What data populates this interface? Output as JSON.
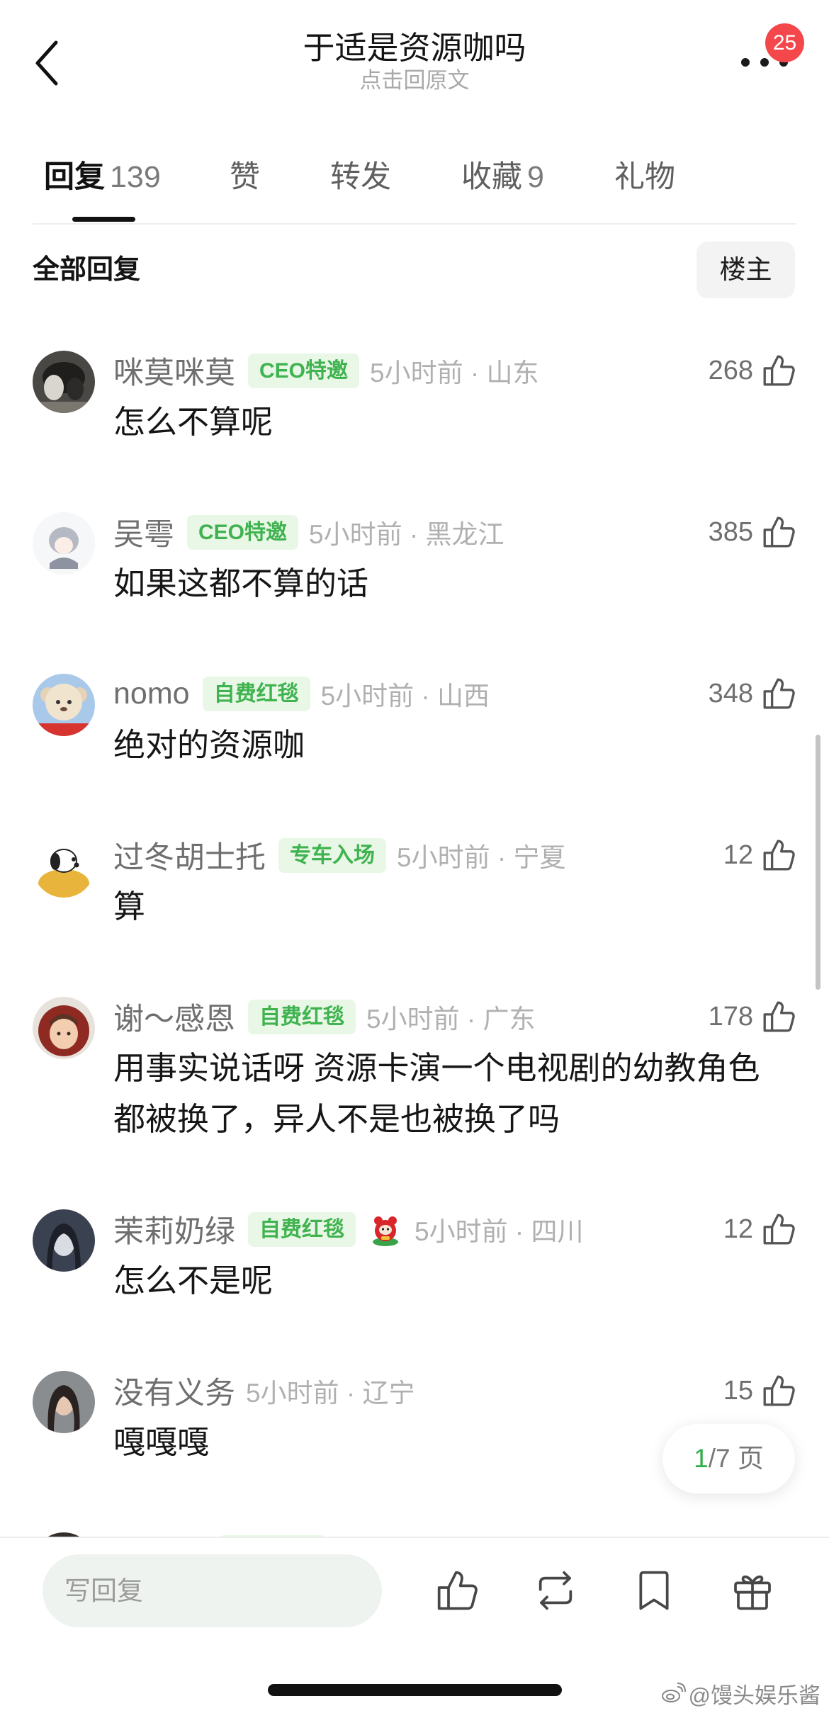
{
  "header": {
    "title": "于适是资源咖吗",
    "subtitle": "点击回原文",
    "notification_count": "25",
    "icons": {
      "back": "back-chevron-icon",
      "more": "more-dots-icon"
    }
  },
  "tabs": [
    {
      "label": "回复",
      "count": "139",
      "active": true
    },
    {
      "label": "赞",
      "active": false
    },
    {
      "label": "转发",
      "active": false
    },
    {
      "label": "收藏",
      "count": "9",
      "active": false
    },
    {
      "label": "礼物",
      "active": false
    }
  ],
  "filter_bar": {
    "title": "全部回复",
    "poster_only_button": "楼主"
  },
  "comments": [
    {
      "name": "咪莫咪莫",
      "badge": "CEO特邀",
      "meta": "5小时前 · 山东",
      "likes": "268",
      "text": "怎么不算呢"
    },
    {
      "name": "吴雩",
      "badge": "CEO特邀",
      "meta": "5小时前 · 黑龙江",
      "likes": "385",
      "text": "如果这都不算的话"
    },
    {
      "name": "nomo",
      "badge": "自费红毯",
      "meta": "5小时前 · 山西",
      "likes": "348",
      "text": "绝对的资源咖"
    },
    {
      "name": "过冬胡士托",
      "badge": "专车入场",
      "meta": "5小时前 · 宁夏",
      "likes": "12",
      "text": "算"
    },
    {
      "name": "谢～感恩",
      "badge": "自费红毯",
      "meta": "5小时前 · 广东",
      "likes": "178",
      "text": "用事实说话呀 资源卡演一个电视剧的幼教角色都被换了，异人不是也被换了吗"
    },
    {
      "name": "茉莉奶绿",
      "badge": "自费红毯",
      "sticker": "red-mascot-sticker-icon",
      "meta": "5小时前 · 四川",
      "likes": "12",
      "text": "怎么不是呢"
    },
    {
      "name": "没有义务",
      "meta": "5小时前 · 辽宁",
      "likes": "15",
      "text": "嘎嘎嘎"
    }
  ],
  "pagination": {
    "current": "1",
    "total": "/7 页"
  },
  "bottom_bar": {
    "reply_placeholder": "写回复",
    "icons": [
      "thumbs-up-icon",
      "repost-icon",
      "bookmark-icon",
      "gift-icon"
    ]
  },
  "watermark": {
    "text": "@馒头娱乐酱",
    "icon": "weibo-logo-icon"
  },
  "colors": {
    "badge_text": "#3fb34f",
    "badge_bg": "#e9f7e6",
    "notification": "#f4474c",
    "page_current": "#2fae47",
    "reply_input_bg": "#eef3ef"
  }
}
